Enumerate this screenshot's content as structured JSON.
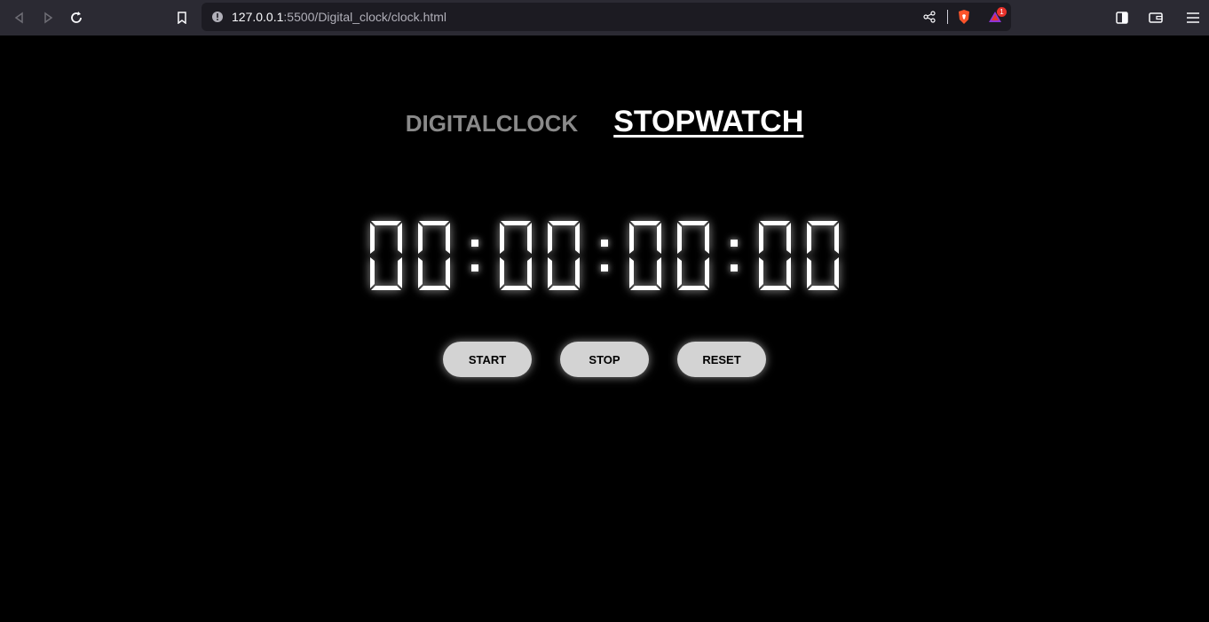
{
  "browser": {
    "url_host": "127.0.0.1",
    "url_path": ":5500/Digital_clock/clock.html",
    "notification_count": "1",
    "icons": [
      "back-icon",
      "forward-icon",
      "reload-icon",
      "bookmark-icon",
      "site-info-icon",
      "share-icon",
      "brave-shields-icon",
      "brave-rewards-icon",
      "sidebar-icon",
      "wallet-icon",
      "menu-icon"
    ]
  },
  "tabs": {
    "clock_label": "DIGITALCLOCK",
    "stopwatch_label": "STOPWATCH"
  },
  "stopwatch": {
    "hours": "00",
    "minutes": "00",
    "seconds": "00",
    "centiseconds": "00",
    "separator": ":"
  },
  "buttons": {
    "start_label": "START",
    "stop_label": "STOP",
    "reset_label": "RESET"
  },
  "colors": {
    "background": "#000000",
    "digit": "#ffffff",
    "button_bg": "#d3d3d3",
    "inactive_tab": "#8a8a8a"
  }
}
